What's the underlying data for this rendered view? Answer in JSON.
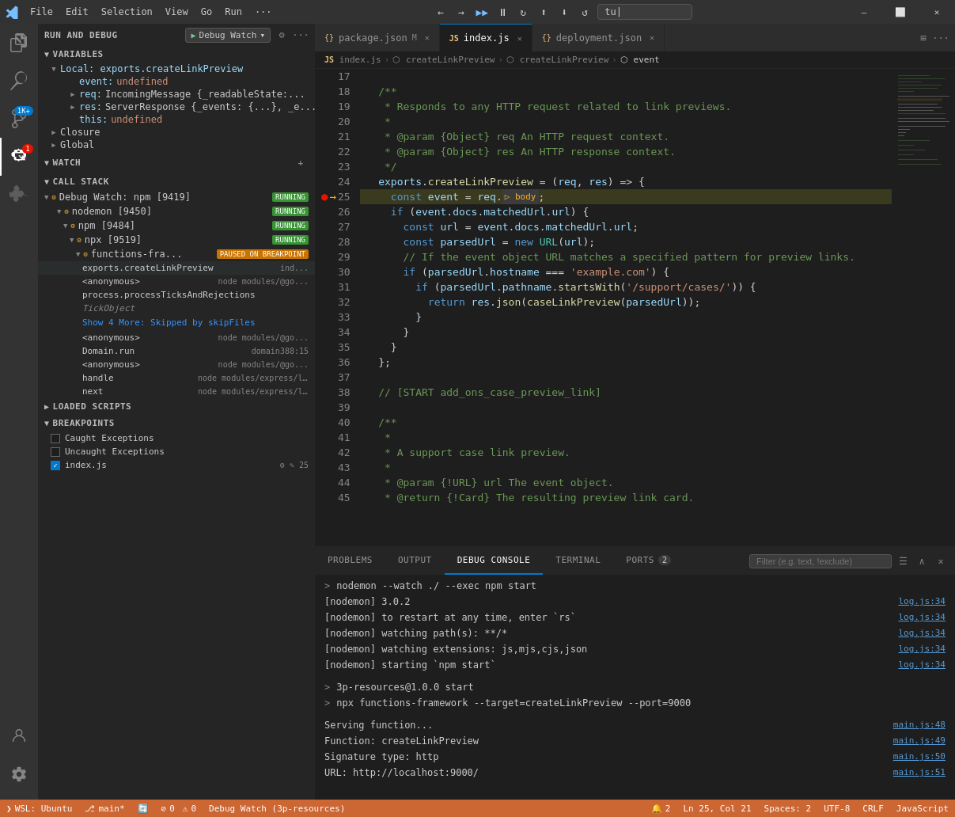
{
  "titleBar": {
    "appIcon": "✦",
    "menuItems": [
      "File",
      "Edit",
      "Selection",
      "View",
      "Go",
      "Run",
      "···"
    ],
    "debugControls": [
      "▶▶",
      "⏸",
      "⏹",
      "⟳",
      "⬆",
      "⬇",
      "↺"
    ],
    "searchPlaceholder": "tu|",
    "windowButtons": [
      "—",
      "⬜",
      "✕"
    ]
  },
  "tabs": [
    {
      "id": "package",
      "icon": "{}",
      "label": "package.json",
      "suffix": "M",
      "active": false,
      "modified": true
    },
    {
      "id": "index",
      "icon": "JS",
      "label": "index.js",
      "active": true
    },
    {
      "id": "deployment",
      "icon": "{}",
      "label": "deployment.json",
      "active": false
    }
  ],
  "breadcrumb": {
    "items": [
      "JS index.js",
      "⬡ createLinkPreview",
      "⬡ createLinkPreview",
      "⬡ event"
    ]
  },
  "sidebar": {
    "runDebugLabel": "RUN AND DEBUG",
    "debugConfig": "Debug Watch",
    "variables": {
      "title": "VARIABLES",
      "local": {
        "label": "Local: exports.createLinkPreview",
        "items": [
          {
            "name": "event:",
            "value": "undefined"
          },
          {
            "name": "req:",
            "value": "IncomingMessage {_readableState:..."
          },
          {
            "name": "res:",
            "value": "ServerResponse {_events: {...}, _e..."
          },
          {
            "name": "this:",
            "value": "undefined"
          }
        ]
      },
      "closure": "Closure",
      "global": "Global"
    },
    "watch": {
      "title": "WATCH"
    },
    "callStack": {
      "title": "CALL STACK",
      "processes": [
        {
          "name": "Debug Watch: npm [9419]",
          "badge": "RUNNING",
          "children": [
            {
              "name": "nodemon [9450]",
              "badge": "RUNNING",
              "children": [
                {
                  "name": "npm [9484]",
                  "badge": "RUNNING",
                  "children": [
                    {
                      "name": "npx [9519]",
                      "badge": "RUNNING",
                      "children": [
                        {
                          "name": "functions-fra...",
                          "badge": "PAUSED ON BREAKPOINT",
                          "paused": true,
                          "frames": [
                            {
                              "name": "exports.createLinkPreview",
                              "file": "ind..."
                            },
                            {
                              "name": "<anonymous>",
                              "file": "node_modules/@go..."
                            },
                            {
                              "name": "process.processTicksAndRejections"
                            },
                            {
                              "name": "TickObject",
                              "special": true
                            },
                            {
                              "name": "Show 4 More: Skipped by skipFiles",
                              "link": true
                            },
                            {
                              "name": "<anonymous>",
                              "file": "node_modules/@go..."
                            },
                            {
                              "name": "Domain.run",
                              "file": "domain",
                              "lineinfo": "388:15"
                            },
                            {
                              "name": "<anonymous>",
                              "file": "node_modules/@go..."
                            },
                            {
                              "name": "handle",
                              "file": "node_modules/express/lib/..."
                            },
                            {
                              "name": "next",
                              "file": "node_modules/express/lib/ro..."
                            }
                          ]
                        }
                      ]
                    }
                  ]
                }
              ]
            }
          ]
        }
      ]
    },
    "loadedScripts": {
      "title": "LOADED SCRIPTS"
    },
    "breakpoints": {
      "title": "BREAKPOINTS",
      "items": [
        {
          "label": "Caught Exceptions",
          "checked": false
        },
        {
          "label": "Uncaught Exceptions",
          "checked": false
        },
        {
          "label": "index.js",
          "checked": true,
          "file": "⚙ ✎ 25"
        }
      ]
    }
  },
  "code": {
    "lines": [
      {
        "num": 17,
        "content": ""
      },
      {
        "num": 18,
        "content": "  /**",
        "type": "comment"
      },
      {
        "num": 19,
        "content": "   * Responds to any HTTP request related to link previews.",
        "type": "comment"
      },
      {
        "num": 20,
        "content": "   *",
        "type": "comment"
      },
      {
        "num": 21,
        "content": "   * @param {Object} req An HTTP request context.",
        "type": "comment"
      },
      {
        "num": 22,
        "content": "   * @param {Object} res An HTTP response context.",
        "type": "comment"
      },
      {
        "num": 23,
        "content": "   */",
        "type": "comment"
      },
      {
        "num": 24,
        "content": "  exports.createLinkPreview = (req, res) => {",
        "type": "code"
      },
      {
        "num": 25,
        "content": "    const event = req.▷ body;",
        "type": "debug",
        "debug": true
      },
      {
        "num": 26,
        "content": "    if (event.docs.matchedUrl.url) {",
        "type": "code"
      },
      {
        "num": 27,
        "content": "      const url = event.docs.matchedUrl.url;",
        "type": "code"
      },
      {
        "num": 28,
        "content": "      const parsedUrl = new URL(url);",
        "type": "code"
      },
      {
        "num": 29,
        "content": "      // If the event object URL matches a specified pattern for preview links.",
        "type": "comment"
      },
      {
        "num": 30,
        "content": "      if (parsedUrl.hostname === 'example.com') {",
        "type": "code"
      },
      {
        "num": 31,
        "content": "        if (parsedUrl.pathname.startsWith('/support/cases/')) {",
        "type": "code"
      },
      {
        "num": 32,
        "content": "          return res.json(caseLinkPreview(parsedUrl));",
        "type": "code"
      },
      {
        "num": 33,
        "content": "        }",
        "type": "code"
      },
      {
        "num": 34,
        "content": "      }",
        "type": "code"
      },
      {
        "num": 35,
        "content": "    }",
        "type": "code"
      },
      {
        "num": 36,
        "content": "  };",
        "type": "code"
      },
      {
        "num": 37,
        "content": ""
      },
      {
        "num": 38,
        "content": "  // [START add_ons_case_preview_link]",
        "type": "comment"
      },
      {
        "num": 39,
        "content": ""
      },
      {
        "num": 40,
        "content": "  /**",
        "type": "comment"
      },
      {
        "num": 41,
        "content": "   *",
        "type": "comment"
      },
      {
        "num": 42,
        "content": "   * A support case link preview.",
        "type": "comment"
      },
      {
        "num": 43,
        "content": "   *",
        "type": "comment"
      },
      {
        "num": 44,
        "content": "   * @param {!URL} url The event object.",
        "type": "comment"
      },
      {
        "num": 45,
        "content": "   * @return {!Card} The resulting preview link card.",
        "type": "comment"
      }
    ]
  },
  "panel": {
    "tabs": [
      {
        "label": "PROBLEMS"
      },
      {
        "label": "OUTPUT"
      },
      {
        "label": "DEBUG CONSOLE",
        "active": true
      },
      {
        "label": "TERMINAL"
      },
      {
        "label": "PORTS",
        "badge": "2"
      }
    ],
    "filterPlaceholder": "Filter (e.g. text, !exclude)",
    "consoleLines": [
      {
        "prompt": ">",
        "text": "nodemon --watch ./ --exec npm start",
        "file": ""
      },
      {
        "prompt": "",
        "text": "[nodemon] 3.0.2",
        "file": "log.js:34"
      },
      {
        "prompt": "",
        "text": "[nodemon] to restart at any time, enter `rs`",
        "file": "log.js:34"
      },
      {
        "prompt": "",
        "text": "[nodemon] watching path(s): **/*",
        "file": "log.js:34"
      },
      {
        "prompt": "",
        "text": "[nodemon] watching extensions: js,mjs,cjs,json",
        "file": "log.js:34"
      },
      {
        "prompt": "",
        "text": "[nodemon] starting `npm start`",
        "file": "log.js:34"
      },
      {
        "prompt": ">",
        "text": "3p-resources@1.0.0 start",
        "file": ""
      },
      {
        "prompt": ">",
        "text": "npx functions-framework --target=createLinkPreview --port=9000",
        "file": ""
      },
      {
        "prompt": "",
        "text": "Serving function...",
        "file": "main.js:48"
      },
      {
        "prompt": "",
        "text": "Function: createLinkPreview",
        "file": "main.js:49"
      },
      {
        "prompt": "",
        "text": "Signature type: http",
        "file": "main.js:50"
      },
      {
        "prompt": "",
        "text": "URL: http://localhost:9000/",
        "file": "main.js:51"
      }
    ]
  },
  "statusBar": {
    "gitBranch": "⎇ main*",
    "syncIcon": "🔄",
    "errors": "⊘ 0",
    "warnings": "⚠ 0",
    "debugLabel": "Debug Watch (3p-resources)",
    "position": "Ln 25, Col 21",
    "spaces": "Spaces: 2",
    "encoding": "UTF-8",
    "lineEnding": "CRLF",
    "language": "JavaScript",
    "wsl": "WSL: Ubuntu",
    "notifications": "🔔 2"
  }
}
